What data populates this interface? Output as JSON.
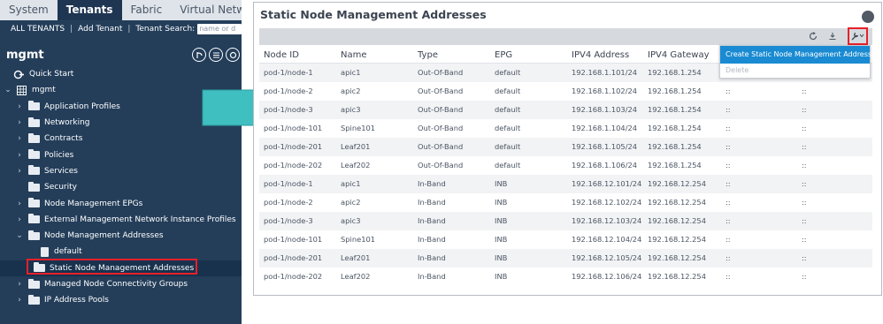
{
  "top_nav": {
    "tabs": [
      "System",
      "Tenants",
      "Fabric",
      "Virtual Networking"
    ],
    "active": "Tenants"
  },
  "sub_nav": {
    "all_tenants": "ALL TENANTS",
    "add_tenant": "Add Tenant",
    "search_label": "Tenant Search:",
    "search_placeholder": "name or d"
  },
  "tenant": {
    "title": "mgmt"
  },
  "tree": [
    {
      "label": "Quick Start"
    },
    {
      "label": "mgmt"
    },
    {
      "label": "Application Profiles"
    },
    {
      "label": "Networking"
    },
    {
      "label": "Contracts"
    },
    {
      "label": "Policies"
    },
    {
      "label": "Services"
    },
    {
      "label": "Security"
    },
    {
      "label": "Node Management EPGs"
    },
    {
      "label": "External Management Network Instance Profiles"
    },
    {
      "label": "Node Management Addresses"
    },
    {
      "label": "default"
    },
    {
      "label": "Static Node Management Addresses"
    },
    {
      "label": "Managed Node Connectivity Groups"
    },
    {
      "label": "IP Address Pools"
    }
  ],
  "panel": {
    "title": "Static Node Management Addresses",
    "columns": [
      "Node ID",
      "Name",
      "Type",
      "EPG",
      "IPV4 Address",
      "IPV4 Gateway",
      "",
      ""
    ],
    "rows": [
      [
        "pod-1/node-1",
        "apic1",
        "Out-Of-Band",
        "default",
        "192.168.1.101/24",
        "192.168.1.254",
        "",
        ""
      ],
      [
        "pod-1/node-2",
        "apic2",
        "Out-Of-Band",
        "default",
        "192.168.1.102/24",
        "192.168.1.254",
        "::",
        "::"
      ],
      [
        "pod-1/node-3",
        "apic3",
        "Out-Of-Band",
        "default",
        "192.168.1.103/24",
        "192.168.1.254",
        "::",
        "::"
      ],
      [
        "pod-1/node-101",
        "Spine101",
        "Out-Of-Band",
        "default",
        "192.168.1.104/24",
        "192.168.1.254",
        "::",
        "::"
      ],
      [
        "pod-1/node-201",
        "Leaf201",
        "Out-Of-Band",
        "default",
        "192.168.1.105/24",
        "192.168.1.254",
        "::",
        "::"
      ],
      [
        "pod-1/node-202",
        "Leaf202",
        "Out-Of-Band",
        "default",
        "192.168.1.106/24",
        "192.168.1.254",
        "::",
        "::"
      ],
      [
        "pod-1/node-1",
        "apic1",
        "In-Band",
        "INB",
        "192.168.12.101/24",
        "192.168.12.254",
        "::",
        "::"
      ],
      [
        "pod-1/node-2",
        "apic2",
        "In-Band",
        "INB",
        "192.168.12.102/24",
        "192.168.12.254",
        "::",
        "::"
      ],
      [
        "pod-1/node-3",
        "apic3",
        "In-Band",
        "INB",
        "192.168.12.103/24",
        "192.168.12.254",
        "::",
        "::"
      ],
      [
        "pod-1/node-101",
        "Spine101",
        "In-Band",
        "INB",
        "192.168.12.104/24",
        "192.168.12.254",
        "::",
        "::"
      ],
      [
        "pod-1/node-201",
        "Leaf201",
        "In-Band",
        "INB",
        "192.168.12.105/24",
        "192.168.12.254",
        "::",
        "::"
      ],
      [
        "pod-1/node-202",
        "Leaf202",
        "In-Band",
        "INB",
        "192.168.12.106/24",
        "192.168.12.254",
        "::",
        "::"
      ]
    ],
    "menu": {
      "create": "Create Static Node Management Addresses",
      "delete": "Delete"
    }
  },
  "colors": {
    "sidebar": "#243e5a",
    "accent": "#1a8bd2",
    "highlight": "#e8202a",
    "arrow": "#3fbfbf"
  }
}
